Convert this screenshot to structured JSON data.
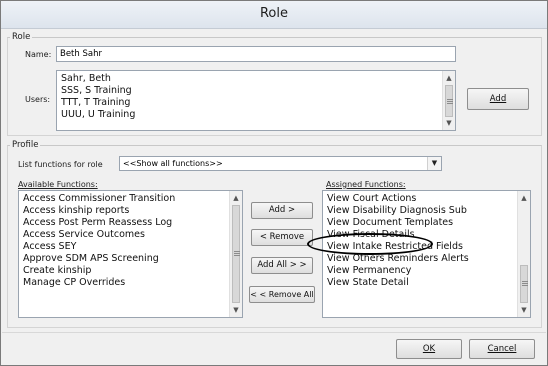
{
  "window": {
    "title": "Role"
  },
  "role_group": {
    "legend": "Role",
    "name_label": "Name:",
    "name_value": "Beth Sahr",
    "users_label": "Users:",
    "users": [
      "Sahr,  Beth",
      "SSS,  S Training",
      "TTT,  T Training",
      "UUU,  U Training"
    ],
    "add_button": "Add"
  },
  "profile_group": {
    "legend": "Profile",
    "list_functions_label": "List functions for role",
    "list_functions_value": "<<Show all functions>>",
    "available_label": "Available Functions:",
    "available": [
      "Access Commissioner Transition",
      "Access kinship reports",
      "Access Post Perm Reassess Log",
      "Access Service Outcomes",
      "Access SEY",
      "Approve SDM APS Screening",
      "Create kinship",
      "Manage CP Overrides"
    ],
    "assigned_label": "Assigned Functions:",
    "assigned": [
      "View Court Actions",
      "View Disability Diagnosis Sub",
      "View Document Templates",
      "View Fiscal Details",
      "View Intake Restricted Fields",
      "View Others Reminders Alerts",
      "View Permanency",
      "View State Detail"
    ],
    "add_button": "Add >",
    "remove_button": "< Remove",
    "add_all_button": "Add All > >",
    "remove_all_button": "< < Remove All"
  },
  "footer": {
    "ok_button": "OK",
    "cancel_button": "Cancel"
  }
}
